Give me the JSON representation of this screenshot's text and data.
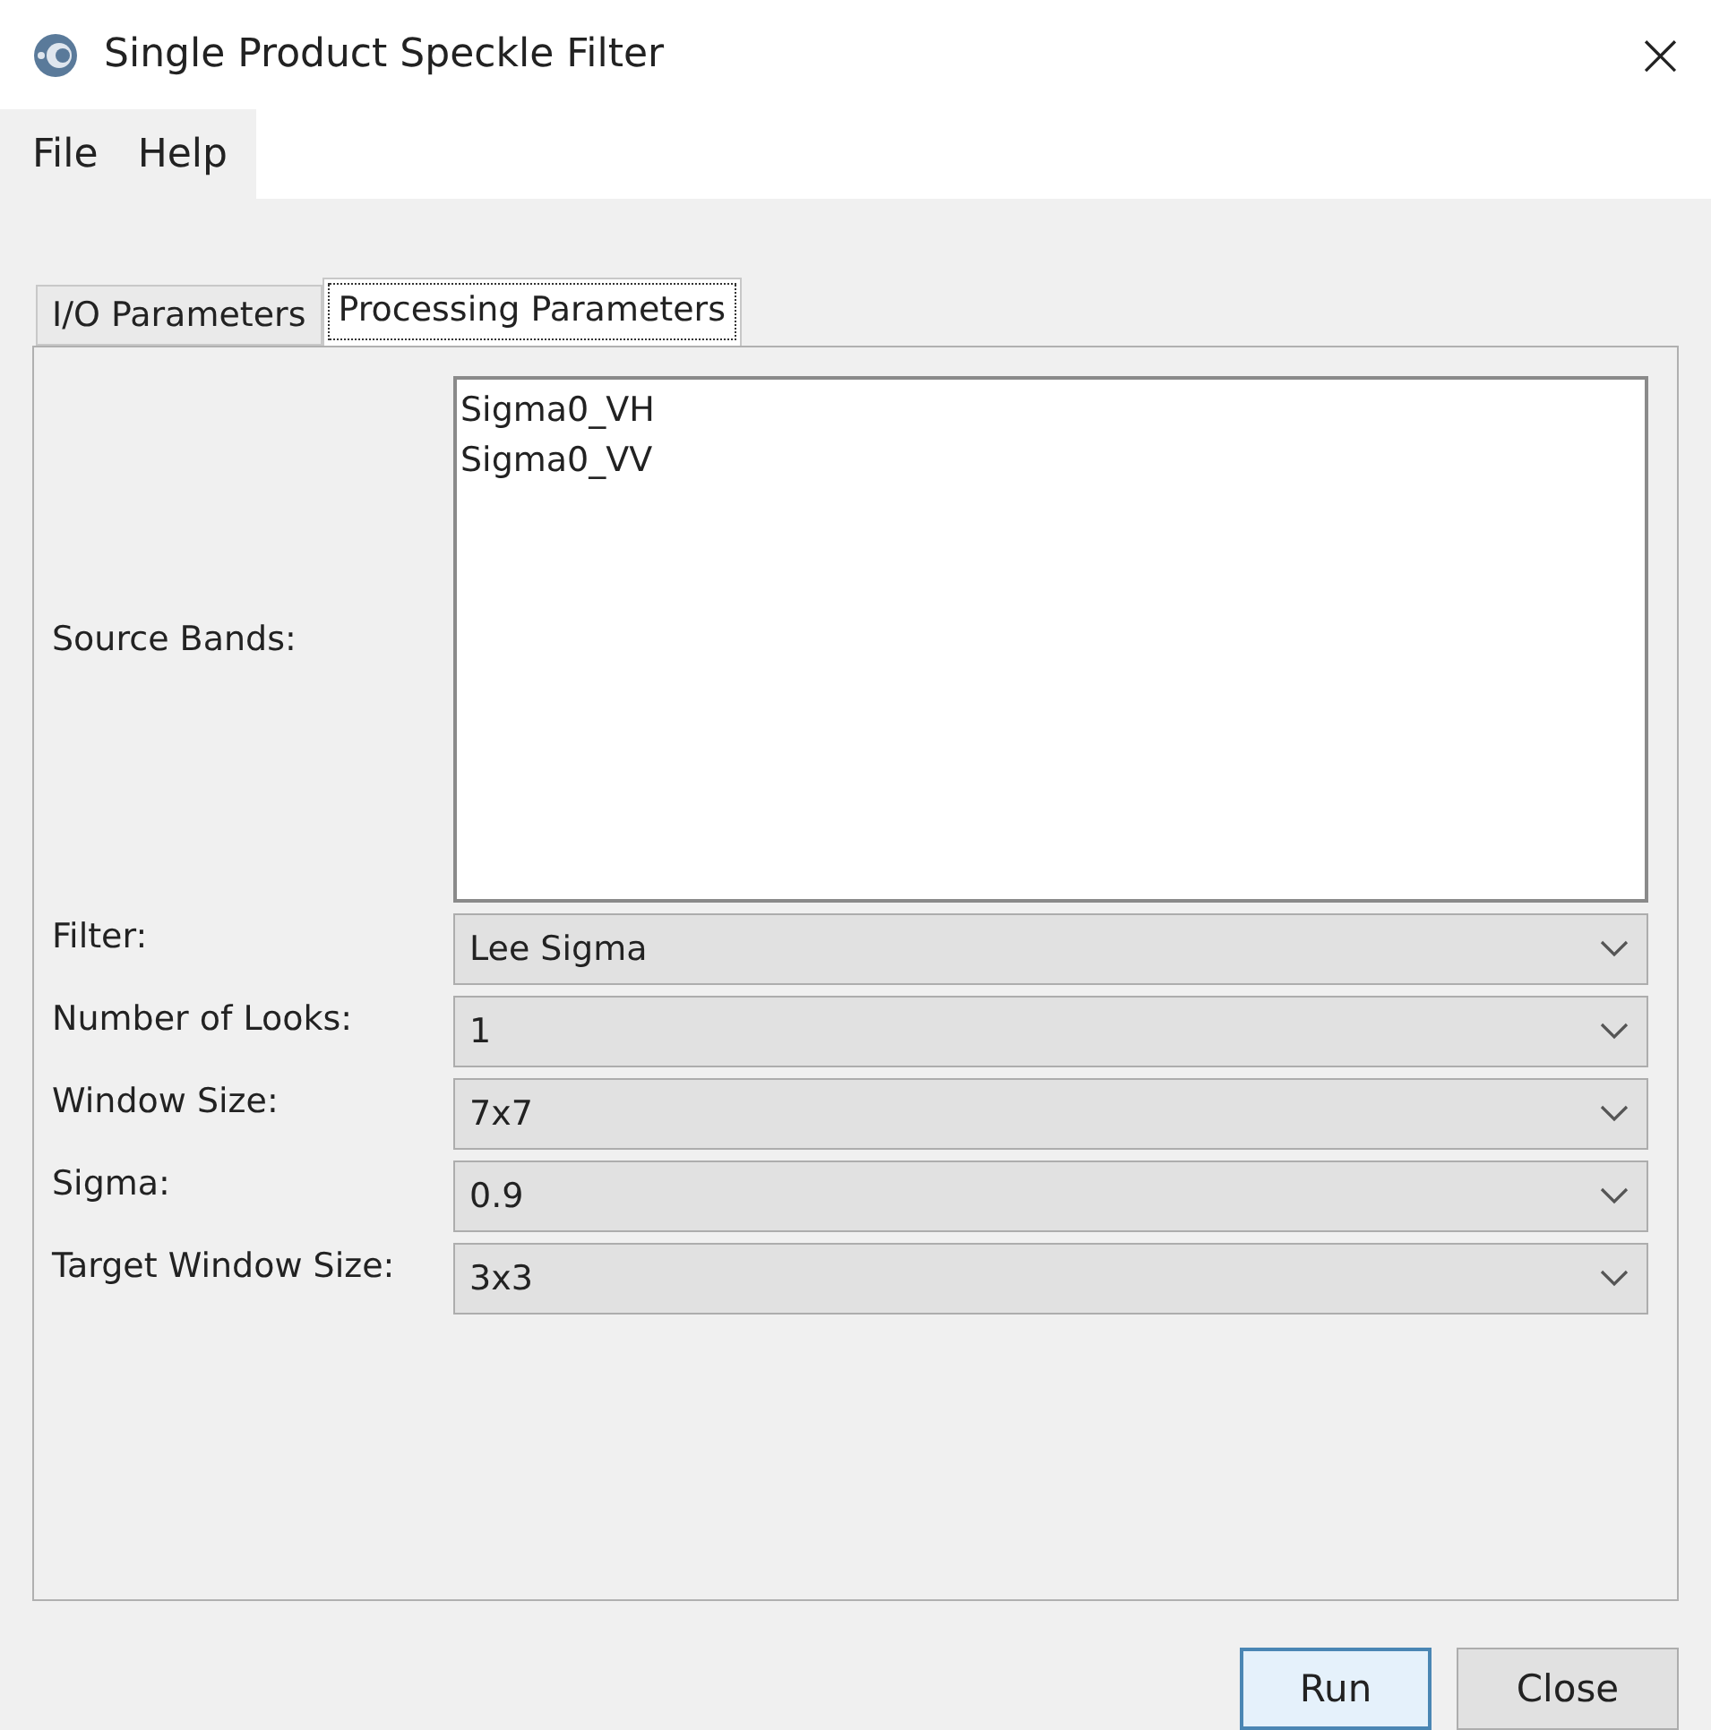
{
  "window": {
    "title": "Single Product Speckle Filter",
    "close": "×"
  },
  "menu": [
    "File",
    "Help"
  ],
  "tabs": [
    {
      "label": "I/O Parameters",
      "selected": false
    },
    {
      "label": "Processing Parameters",
      "selected": true
    }
  ],
  "source_bands": {
    "label": "Source Bands:",
    "items": [
      "Sigma0_VH",
      "Sigma0_VV"
    ]
  },
  "fields": [
    {
      "label": "Filter:",
      "value": "Lee Sigma"
    },
    {
      "label": "Number of Looks:",
      "value": "1"
    },
    {
      "label": "Window Size:",
      "value": "7x7"
    },
    {
      "label": "Sigma:",
      "value": "0.9"
    },
    {
      "label": "Target Window Size:",
      "value": "3x3"
    }
  ],
  "buttons": [
    {
      "label": "Run",
      "default": true
    },
    {
      "label": "Close",
      "default": false
    }
  ]
}
